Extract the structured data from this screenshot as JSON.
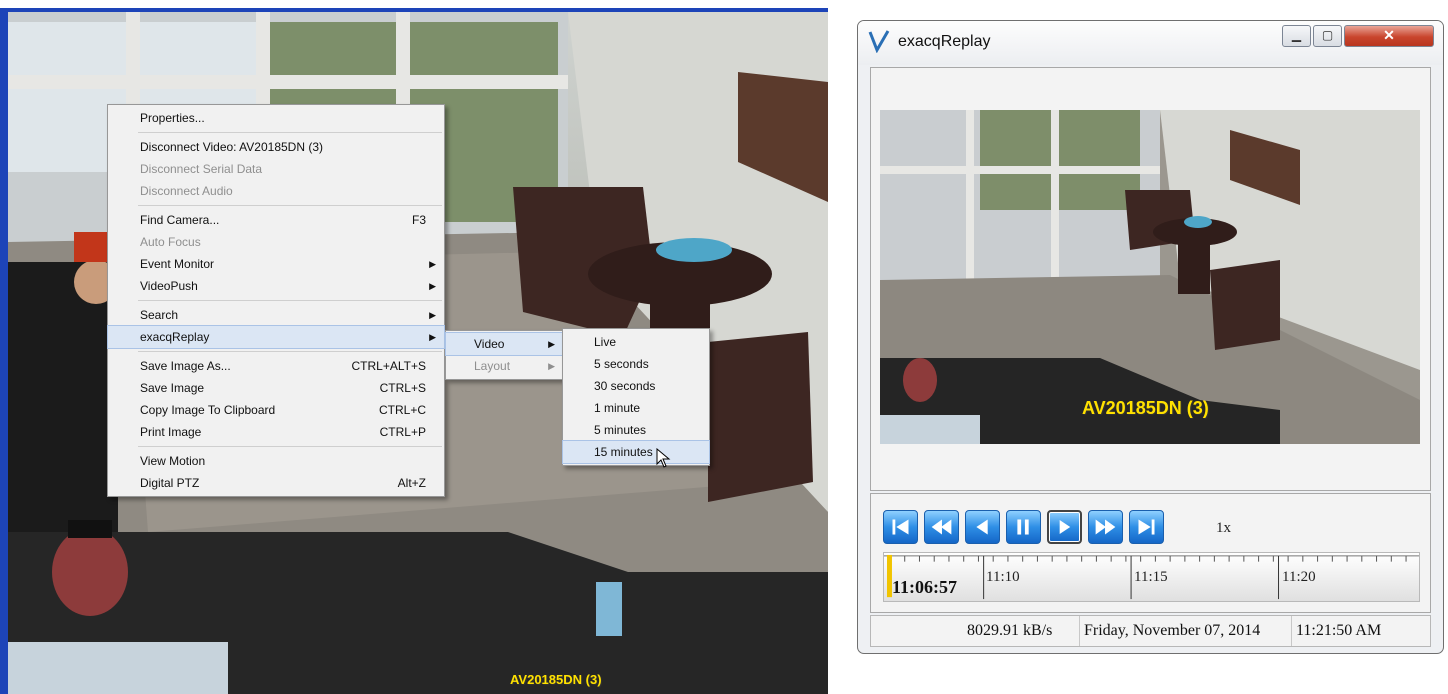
{
  "left": {
    "camera_label": "AV20185DN (3)"
  },
  "main_menu": {
    "groups": [
      [
        {
          "label": "Properties...",
          "disabled": false
        }
      ],
      [
        {
          "label": "Disconnect Video: AV20185DN (3)",
          "disabled": false
        },
        {
          "label": "Disconnect Serial Data",
          "disabled": true
        },
        {
          "label": "Disconnect Audio",
          "disabled": true
        }
      ],
      [
        {
          "label": "Find Camera...",
          "shortcut": "F3",
          "disabled": false
        },
        {
          "label": "Auto Focus",
          "disabled": true
        },
        {
          "label": "Event Monitor",
          "submenu": true,
          "disabled": false
        },
        {
          "label": "VideoPush",
          "submenu": true,
          "disabled": false
        }
      ],
      [
        {
          "label": "Search",
          "submenu": true,
          "disabled": false
        },
        {
          "label": "exacqReplay",
          "submenu": true,
          "disabled": false,
          "highlighted": true
        }
      ],
      [
        {
          "label": "Save Image As...",
          "shortcut": "CTRL+ALT+S",
          "disabled": false
        },
        {
          "label": "Save Image",
          "shortcut": "CTRL+S",
          "disabled": false
        },
        {
          "label": "Copy Image To Clipboard",
          "shortcut": "CTRL+C",
          "disabled": false
        },
        {
          "label": "Print Image",
          "shortcut": "CTRL+P",
          "disabled": false
        }
      ],
      [
        {
          "label": "View Motion",
          "disabled": false
        },
        {
          "label": "Digital PTZ",
          "shortcut": "Alt+Z",
          "disabled": false
        }
      ]
    ]
  },
  "sub_menu": {
    "items": [
      {
        "label": "Video",
        "submenu": true,
        "disabled": false,
        "highlighted": true
      },
      {
        "label": "Layout",
        "submenu": true,
        "disabled": true
      }
    ]
  },
  "time_menu": {
    "items": [
      {
        "label": "Live",
        "highlighted": false
      },
      {
        "label": "5 seconds",
        "highlighted": false
      },
      {
        "label": "30 seconds",
        "highlighted": false
      },
      {
        "label": "1 minute",
        "highlighted": false
      },
      {
        "label": "5 minutes",
        "highlighted": false
      },
      {
        "label": "15 minutes",
        "highlighted": true
      }
    ]
  },
  "replay": {
    "title": "exacqReplay",
    "camera_label": "AV20185DN (3)",
    "speed": "1x",
    "controls": [
      {
        "name": "skip-start-button",
        "icon": "skip-start-icon"
      },
      {
        "name": "rewind-button",
        "icon": "rewind-icon"
      },
      {
        "name": "step-back-button",
        "icon": "step-back-icon"
      },
      {
        "name": "pause-button",
        "icon": "pause-icon"
      },
      {
        "name": "play-button",
        "icon": "play-icon",
        "active": true
      },
      {
        "name": "fast-forward-button",
        "icon": "fast-forward-icon"
      },
      {
        "name": "skip-end-button",
        "icon": "skip-end-icon"
      }
    ],
    "timeline": {
      "current_time": "11:06:57",
      "tick_labels": [
        "11:10",
        "11:15",
        "11:20"
      ]
    },
    "status": {
      "rate": "8029.91 kB/s",
      "date": "Friday, November 07, 2014",
      "time": "11:21:50 AM"
    },
    "colors": {
      "control_blue": "#2f8fe6",
      "close_red": "#c9452d",
      "label_yellow": "#ffe100"
    }
  }
}
